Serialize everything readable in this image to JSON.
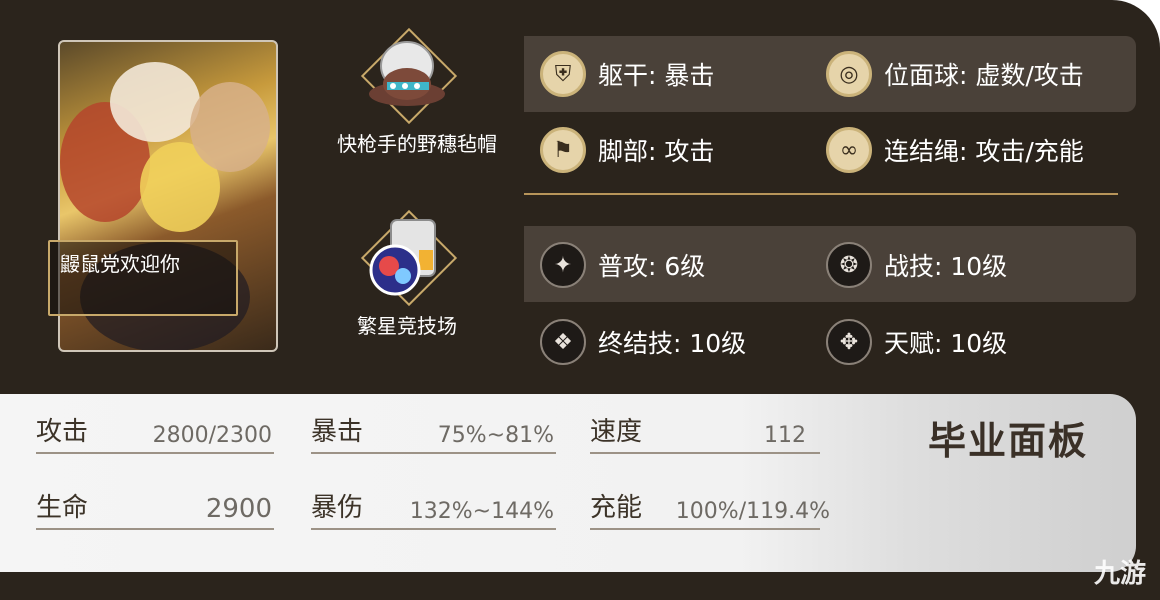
{
  "lightcone": {
    "name": "鼹鼠党欢迎你"
  },
  "relics": [
    {
      "name": "快枪手的野穗毡帽"
    },
    {
      "name": "繁星竞技场"
    }
  ],
  "main_stats": [
    {
      "label": "躯干: 暴击",
      "icon": "armor-icon"
    },
    {
      "label": "位面球: 虚数/攻击",
      "icon": "planar-sphere-icon"
    },
    {
      "label": "脚部: 攻击",
      "icon": "boots-icon"
    },
    {
      "label": "连结绳: 攻击/充能",
      "icon": "link-rope-icon"
    }
  ],
  "skills": [
    {
      "label": "普攻: 6级",
      "icon": "basic-attack-icon"
    },
    {
      "label": "战技: 10级",
      "icon": "skill-icon"
    },
    {
      "label": "终结技: 10级",
      "icon": "ultimate-icon"
    },
    {
      "label": "天赋: 10级",
      "icon": "talent-icon"
    }
  ],
  "stats_panel": {
    "title": "毕业面板",
    "items": [
      {
        "key": "攻击",
        "value": "2800/2300"
      },
      {
        "key": "暴击",
        "value": "75%~81%"
      },
      {
        "key": "速度",
        "value": "112"
      },
      {
        "key": "生命",
        "value": "2900"
      },
      {
        "key": "暴伤",
        "value": "132%~144%"
      },
      {
        "key": "充能",
        "value": "100%/119.4%"
      }
    ]
  },
  "watermark": "九游",
  "colors": {
    "panel_bg": "#2b241c",
    "accent_gold": "#c8a96a",
    "row_bg": "#4a4139",
    "stats_bg": "#f3f3f3"
  }
}
